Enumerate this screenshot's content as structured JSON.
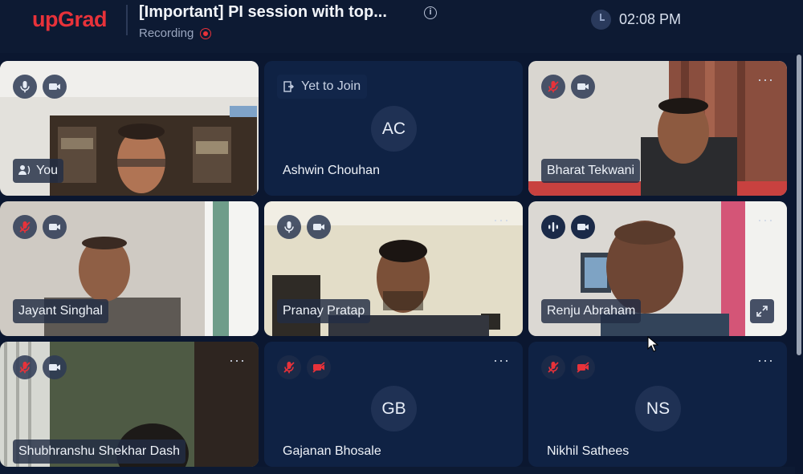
{
  "header": {
    "logo": "upGrad",
    "title": "[Important] PI session with top...",
    "info_icon": "i",
    "recording_label": "Recording",
    "time": "02:08 PM"
  },
  "tiles": [
    {
      "name": "You",
      "type": "video",
      "mic": "on",
      "cam": "on"
    },
    {
      "name": "Ashwin Chouhan",
      "type": "avatar",
      "initials": "AC",
      "status": "Yet to Join"
    },
    {
      "name": "Bharat Tekwani",
      "type": "video",
      "mic": "off",
      "cam": "on",
      "more": "···"
    },
    {
      "name": "Jayant Singhal",
      "type": "video",
      "mic": "off",
      "cam": "on"
    },
    {
      "name": "Pranay Pratap",
      "type": "video",
      "mic": "on",
      "cam": "on",
      "more": "···"
    },
    {
      "name": "Renju Abraham",
      "type": "video",
      "mic": "speaking",
      "cam": "on",
      "more": "···"
    },
    {
      "name": "Shubhranshu Shekhar Dash",
      "type": "video",
      "mic": "off",
      "cam": "on",
      "more": "···"
    },
    {
      "name": "Gajanan Bhosale",
      "type": "avatar",
      "initials": "GB",
      "mic": "off",
      "cam": "off",
      "more": "···"
    },
    {
      "name": "Nikhil Sathees",
      "type": "avatar",
      "initials": "NS",
      "mic": "off",
      "cam": "off",
      "more": "···"
    }
  ],
  "colors": {
    "brand": "#e8323a",
    "background": "#0b1730",
    "tile": "#0f2244",
    "muted": "#e8323a"
  }
}
